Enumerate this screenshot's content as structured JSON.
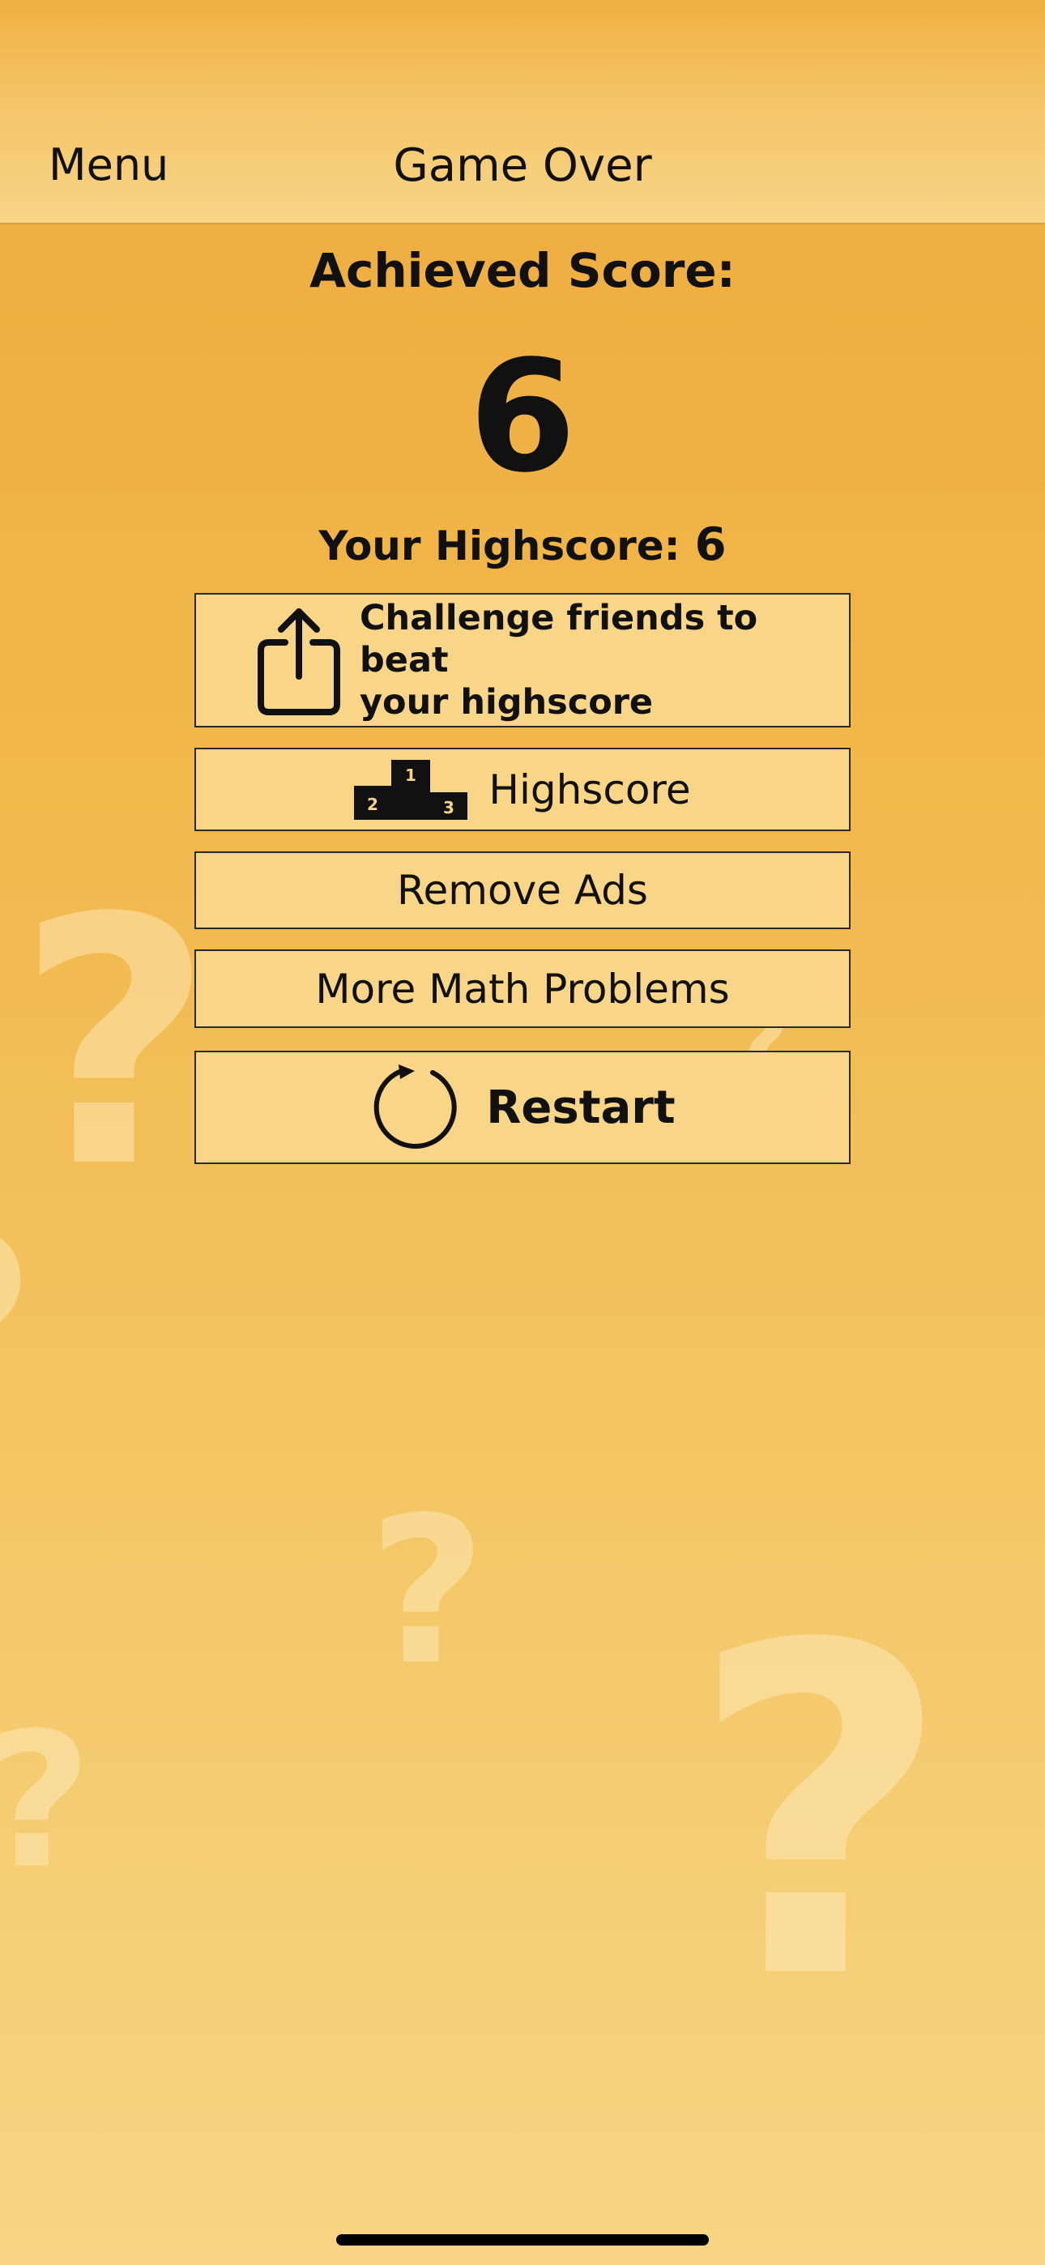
{
  "navbar": {
    "menu_label": "Menu",
    "title": "Game Over"
  },
  "score": {
    "label": "Achieved Score:",
    "value": "6",
    "highscore_label": "Your Highscore:",
    "highscore_value": "6"
  },
  "buttons": {
    "share": {
      "label": "Challenge friends to beat\nyour highscore",
      "icon": "share-icon"
    },
    "highscore": {
      "label": "Highscore",
      "icon": "podium-icon",
      "podium_places": [
        "1",
        "2",
        "3"
      ]
    },
    "remove_ads": {
      "label": "Remove Ads"
    },
    "more_math": {
      "label": "More Math Problems"
    },
    "restart": {
      "label": "Restart",
      "icon": "restart-icon"
    }
  },
  "background": {
    "decoration_glyph": "?"
  },
  "colors": {
    "background_top": "#EEAA3C",
    "background_bottom": "#F8D584",
    "button_fill": "#F8D587",
    "button_border": "#2a2a2a",
    "text": "#111111"
  }
}
